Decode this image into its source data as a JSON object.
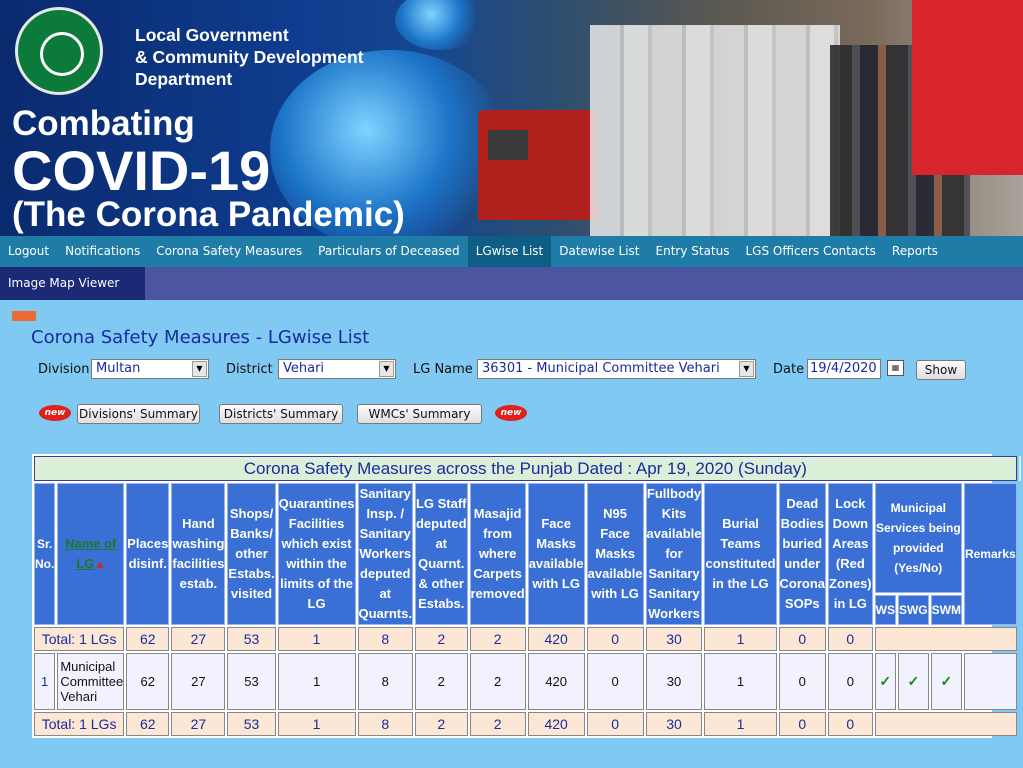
{
  "banner": {
    "dept_lines": [
      "Local Government",
      "& Community Development",
      "Department"
    ],
    "headline1": "Combating",
    "headline2": "COVID-19",
    "headline3": "(The Corona Pandemic)"
  },
  "nav": {
    "items": [
      "Logout",
      "Notifications",
      "Corona Safety Measures",
      "Particulars of Deceased",
      "LGwise List",
      "Datewise List",
      "Entry Status",
      "LGS Officers Contacts",
      "Reports"
    ],
    "active": "LGwise List"
  },
  "subnav": {
    "image_map_viewer": "Image Map Viewer"
  },
  "page_title": "Corona Safety Measures - LGwise List",
  "filters": {
    "division_label": "Division",
    "division_value": "Multan",
    "district_label": "District",
    "district_value": "Vehari",
    "lg_label": "LG Name",
    "lg_value": "36301 - Municipal Committee Vehari",
    "date_label": "Date",
    "date_value": "19/4/2020",
    "show_button": "Show"
  },
  "summary_buttons": {
    "new_badge": "new",
    "divisions": "Divisions' Summary",
    "districts": "Districts' Summary",
    "wmcs": "WMCs' Summary"
  },
  "table": {
    "caption": "Corona Safety Measures across the Punjab Dated : Apr 19, 2020 (Sunday)",
    "headers": {
      "sr": "Sr. No.",
      "name": "Name of LG",
      "places": "Places disinf.",
      "hand": "Hand washing facilities estab.",
      "shops": "Shops/ Banks/ other Estabs. visited",
      "quarantines": "Quarantines Facilities which exist within the limits of the LG",
      "sanitary": "Sanitary Insp. / Sanitary Workers deputed at Quarnts.",
      "lgstaff": "LG Staff deputed at Quarnt. & other Estabs.",
      "masajid": "Masajid from where Carpets removed",
      "face": "Face Masks available with LG",
      "n95": "N95 Face Masks available with LG",
      "fullbody": "Fullbody Kits available for Sanitary Sanitary Workers",
      "burial": "Burial Teams constituted in the LG",
      "dead": "Dead Bodies buried under Corona SOPs",
      "lockdown": "Lock Down Areas (Red Zones) in LG",
      "municipal": "Municipal Services being provided (Yes/No)",
      "ws": "WS",
      "swg": "SWG",
      "swm": "SWM",
      "remarks": "Remarks"
    },
    "total_label": "Total: 1 LGs",
    "totals": [
      "62",
      "27",
      "53",
      "1",
      "8",
      "2",
      "2",
      "420",
      "0",
      "30",
      "1",
      "0",
      "0"
    ],
    "row": {
      "sr": "1",
      "name": "Municipal Committee Vehari",
      "values": [
        "62",
        "27",
        "53",
        "1",
        "8",
        "2",
        "2",
        "420",
        "0",
        "30",
        "1",
        "0",
        "0"
      ],
      "ws": "✓",
      "swg": "✓",
      "swm": "✓",
      "remarks": ""
    }
  }
}
